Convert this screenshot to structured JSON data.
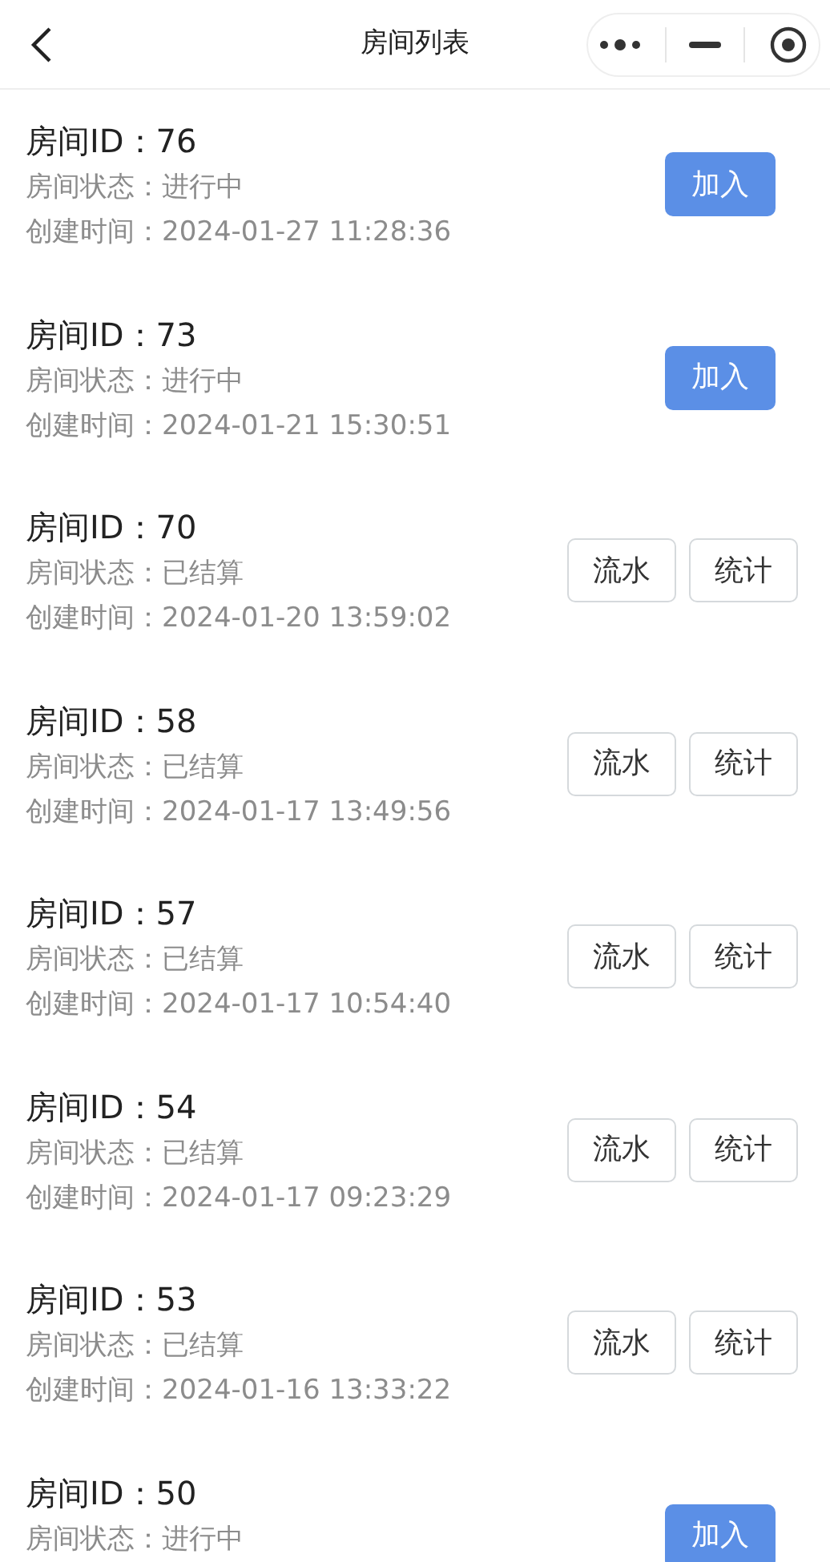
{
  "header": {
    "title": "房间列表"
  },
  "rooms": [
    {
      "id": "房间ID：76",
      "status": "房间状态：进行中",
      "time": "创建时间：2024-01-27 11:28:36",
      "actions": [
        {
          "kind": "primary",
          "label": "加入"
        }
      ]
    },
    {
      "id": "房间ID：73",
      "status": "房间状态：进行中",
      "time": "创建时间：2024-01-21 15:30:51",
      "actions": [
        {
          "kind": "primary",
          "label": "加入"
        }
      ]
    },
    {
      "id": "房间ID：70",
      "status": "房间状态：已结算",
      "time": "创建时间：2024-01-20 13:59:02",
      "actions": [
        {
          "kind": "outline",
          "label": "流水"
        },
        {
          "kind": "outline",
          "label": "统计"
        }
      ]
    },
    {
      "id": "房间ID：58",
      "status": "房间状态：已结算",
      "time": "创建时间：2024-01-17 13:49:56",
      "actions": [
        {
          "kind": "outline",
          "label": "流水"
        },
        {
          "kind": "outline",
          "label": "统计"
        }
      ]
    },
    {
      "id": "房间ID：57",
      "status": "房间状态：已结算",
      "time": "创建时间：2024-01-17 10:54:40",
      "actions": [
        {
          "kind": "outline",
          "label": "流水"
        },
        {
          "kind": "outline",
          "label": "统计"
        }
      ]
    },
    {
      "id": "房间ID：54",
      "status": "房间状态：已结算",
      "time": "创建时间：2024-01-17 09:23:29",
      "actions": [
        {
          "kind": "outline",
          "label": "流水"
        },
        {
          "kind": "outline",
          "label": "统计"
        }
      ]
    },
    {
      "id": "房间ID：53",
      "status": "房间状态：已结算",
      "time": "创建时间：2024-01-16 13:33:22",
      "actions": [
        {
          "kind": "outline",
          "label": "流水"
        },
        {
          "kind": "outline",
          "label": "统计"
        }
      ]
    },
    {
      "id": "房间ID：50",
      "status": "房间状态：进行中",
      "actions": [
        {
          "kind": "primary",
          "label": "加入"
        }
      ]
    }
  ]
}
